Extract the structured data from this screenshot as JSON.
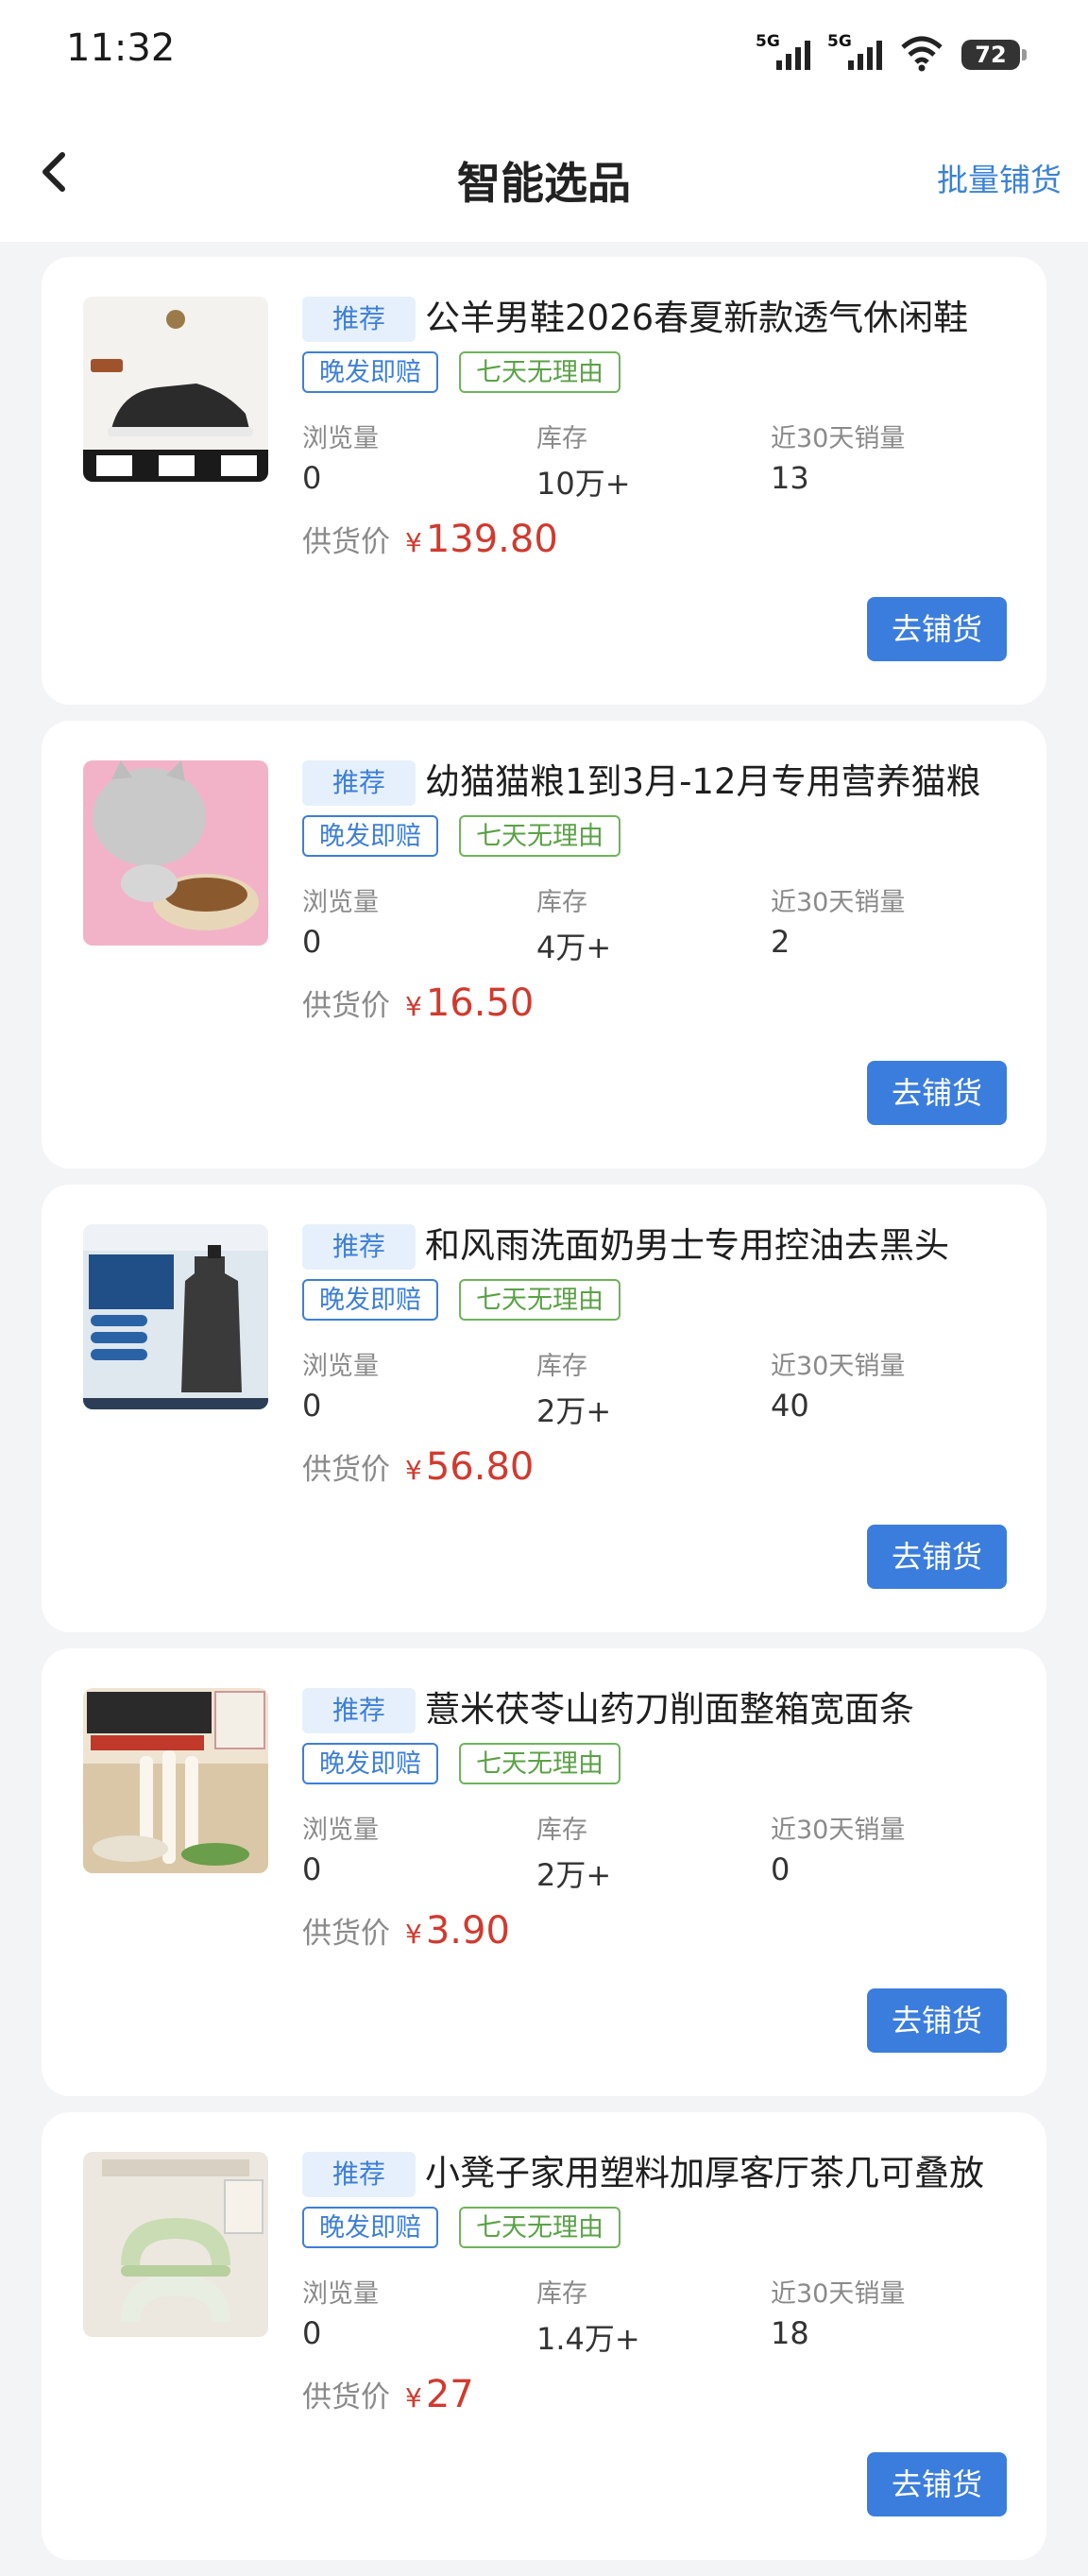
{
  "status_bar": {
    "time": "11:32",
    "signal1_tag": "5G",
    "signal2_tag": "5G",
    "battery": "72"
  },
  "header": {
    "title": "智能选品",
    "action": "批量铺货"
  },
  "labels": {
    "recommend": "推荐",
    "late_compensation": "晚发即赔",
    "seven_day_return": "七天无理由",
    "views": "浏览量",
    "stock": "库存",
    "sales_30d": "近30天销量",
    "supply_price": "供货价",
    "yen": "¥",
    "distribute": "去铺货"
  },
  "products": [
    {
      "name": "公羊男鞋2026春夏新款透气休闲鞋",
      "views": "0",
      "stock": "10万+",
      "sales": "13",
      "price": "139.80",
      "image": "shoe-image"
    },
    {
      "name": "幼猫猫粮1到3月-12月专用营养猫粮",
      "views": "0",
      "stock": "4万+",
      "sales": "2",
      "price": "16.50",
      "image": "cat-food-image"
    },
    {
      "name": "和风雨洗面奶男士专用控油去黑头",
      "views": "0",
      "stock": "2万+",
      "sales": "40",
      "price": "56.80",
      "image": "cleanser-image"
    },
    {
      "name": "薏米茯苓山药刀削面整箱宽面条",
      "views": "0",
      "stock": "2万+",
      "sales": "0",
      "price": "3.90",
      "image": "noodle-image"
    },
    {
      "name": "小凳子家用塑料加厚客厅茶几可叠放",
      "views": "0",
      "stock": "1.4万+",
      "sales": "18",
      "price": "27",
      "image": "stool-image"
    }
  ],
  "colors": {
    "accent": "#3b7ddd",
    "price": "#d13a2f",
    "green_badge": "#6fb35a"
  }
}
